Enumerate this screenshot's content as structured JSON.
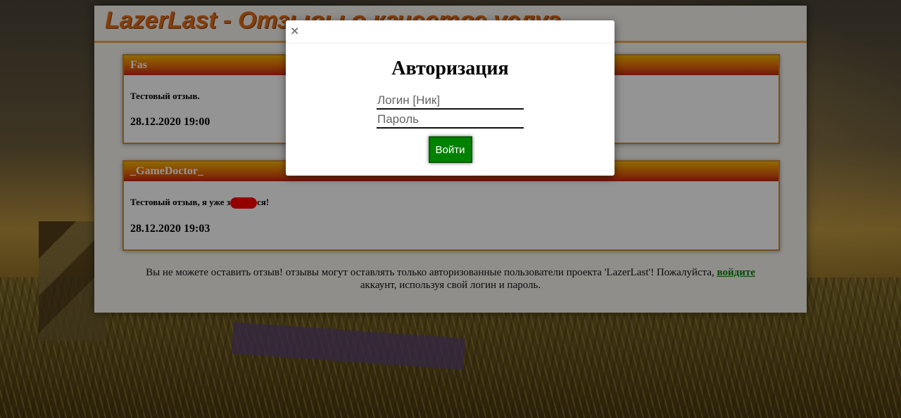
{
  "site": {
    "title": "LazerLast - Отзывы о качестве услуг"
  },
  "reviews": [
    {
      "author": "Fas",
      "text": "Тестовый отзыв.",
      "date": "28.12.2020 19:00"
    },
    {
      "author": "_GameDoctor_",
      "text_before": "Тестовый отзыв, я уже з",
      "text_after": "ся!",
      "date": "28.12.2020 19:03"
    }
  ],
  "notice": {
    "text_before": "Вы не можете оставить отзыв! отзывы могут оставлять только авторизованные пользователи проекта 'LazerLast'! Пожалуйста, ",
    "link": "войдите",
    "text_after": "аккаунт, используя свой логин и пароль."
  },
  "modal": {
    "close_label": "×",
    "title": "Авторизация",
    "login_placeholder": "Логин [Ник]",
    "password_placeholder": "Пароль",
    "submit_label": "Войти"
  },
  "colors": {
    "accent": "#e06b17",
    "header_gradient_top": "#f6b600",
    "header_gradient_bottom": "#c22810",
    "submit_bg": "#008200",
    "link": "#0a7d0a"
  }
}
